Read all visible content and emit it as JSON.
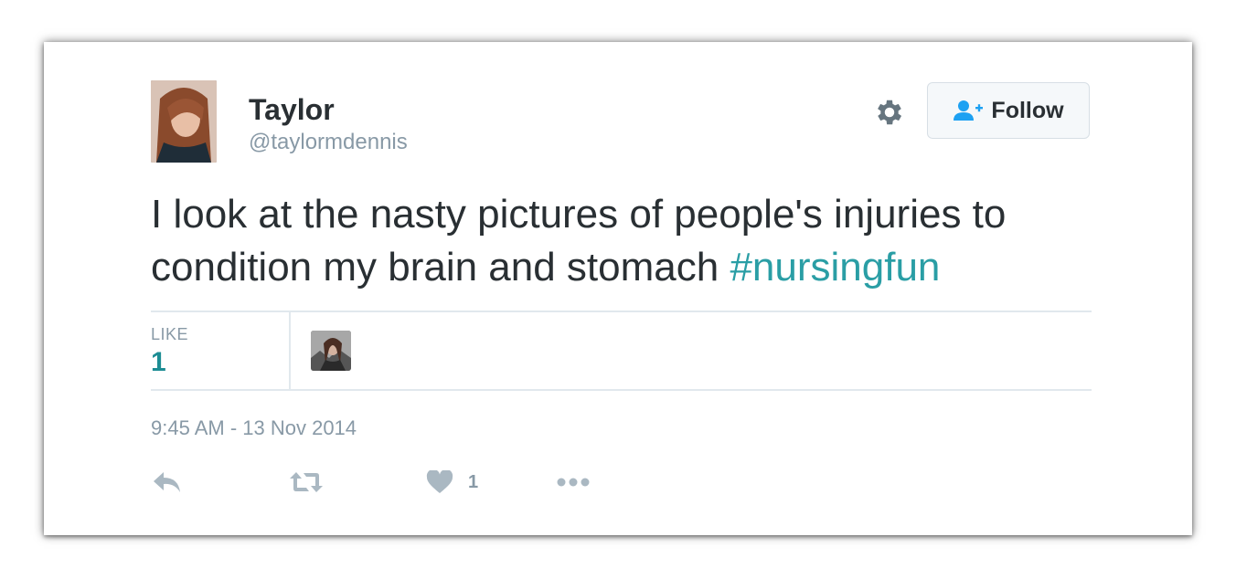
{
  "user": {
    "name": "Taylor",
    "handle": "@taylormdennis"
  },
  "follow_button": {
    "label": "Follow"
  },
  "tweet": {
    "text": "I look at the nasty pictures of people's injuries to condition my brain and stomach ",
    "hashtag": "#nursingfun",
    "timestamp": "9:45 AM - 13 Nov 2014"
  },
  "stats": {
    "likes_label": "LIKE",
    "likes_value": "1"
  },
  "actions": {
    "like_count": "1",
    "icons": [
      "reply-icon",
      "retweet-icon",
      "heart-icon",
      "more-icon"
    ]
  },
  "colors": {
    "text": "#292f33",
    "muted": "#8899a6",
    "hashtag": "#2a9ea5",
    "stat_value": "#1d8d94",
    "follow_icon": "#1da1f2",
    "divider": "#e1e8ed"
  }
}
